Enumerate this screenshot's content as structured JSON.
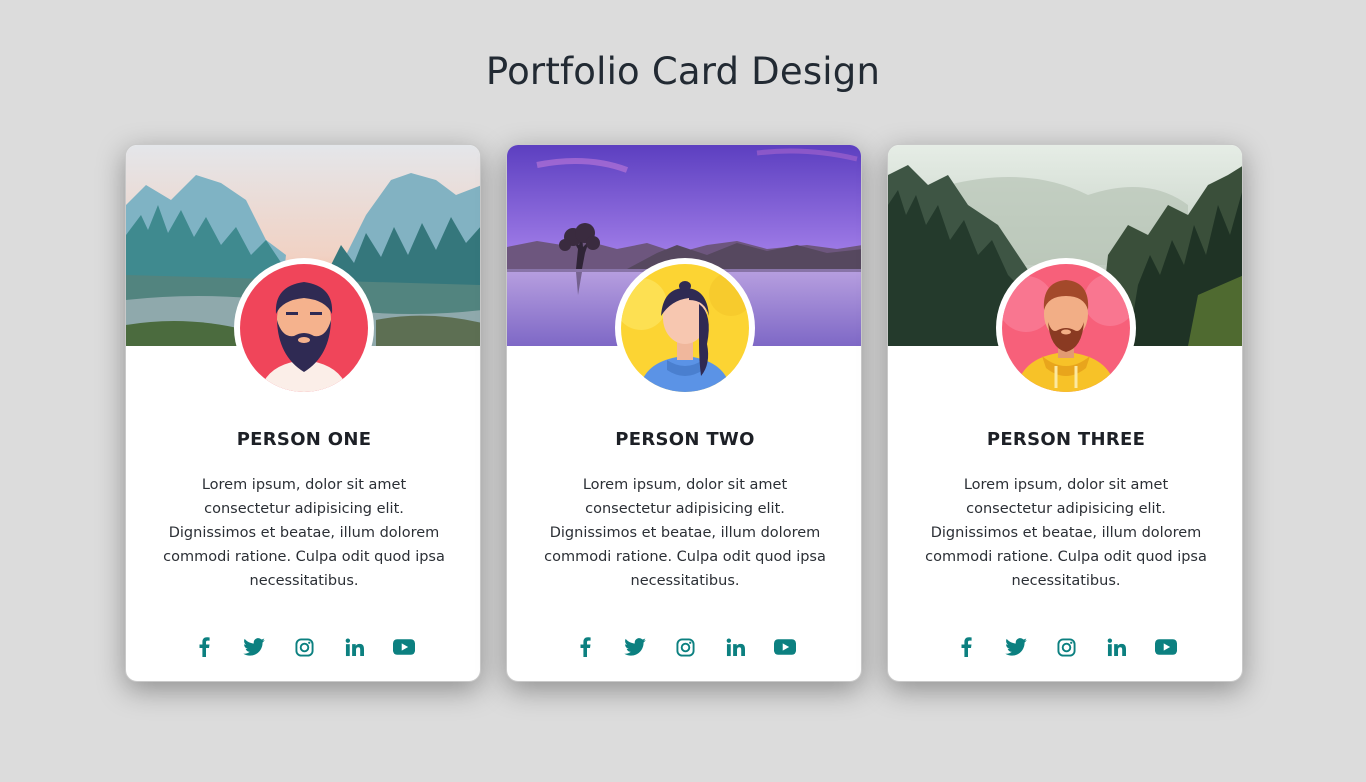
{
  "page": {
    "title": "Portfolio Card Design"
  },
  "colors": {
    "background": "#dcdcdc",
    "accent": "#0c8080",
    "card": "#ffffff"
  },
  "cards": [
    {
      "name": "PERSON ONE",
      "bio": "Lorem ipsum, dolor sit amet consectetur adipisicing elit. Dignissimos et beatae, illum dolorem commodi ratione. Culpa odit quod ipsa necessitatibus.",
      "cover": "mountain-valley-river-image",
      "avatar": "bearded-man-avatar"
    },
    {
      "name": "PERSON TWO",
      "bio": "Lorem ipsum, dolor sit amet consectetur adipisicing elit. Dignissimos et beatae, illum dolorem commodi ratione. Culpa odit quod ipsa necessitatibus.",
      "cover": "purple-lake-tree-image",
      "avatar": "woman-avatar"
    },
    {
      "name": "PERSON THREE",
      "bio": "Lorem ipsum, dolor sit amet consectetur adipisicing elit. Dignissimos et beatae, illum dolorem commodi ratione. Culpa odit quod ipsa necessitatibus.",
      "cover": "misty-forest-image",
      "avatar": "man-hoodie-avatar"
    }
  ],
  "social_icons": [
    "facebook-icon",
    "twitter-icon",
    "instagram-icon",
    "linkedin-icon",
    "youtube-icon"
  ]
}
